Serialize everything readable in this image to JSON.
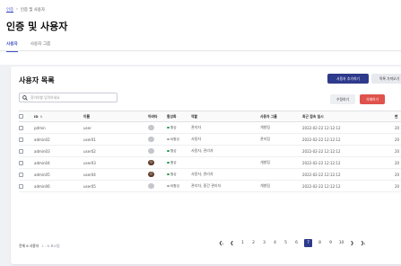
{
  "breadcrumb": {
    "home": "인증",
    "separator": "›",
    "current": "인증 및 사용자"
  },
  "page_title": "인증 및 사용자",
  "tabs": [
    {
      "label": "사용자",
      "active": true
    },
    {
      "label": "사용자 그룹",
      "active": false
    }
  ],
  "card": {
    "title": "사용자 목록",
    "add_button": "사용자 추가하기",
    "columns_button": "목록 가져오기",
    "search_placeholder": "찾아야할 입력하세요",
    "edit_button": "수정하기",
    "delete_button": "삭제하기"
  },
  "table": {
    "headers": {
      "id": "ID",
      "name": "이름",
      "avatar": "아바타",
      "status": "활성화",
      "role": "역할",
      "group": "사용자 그룹",
      "last_login": "최근 접속 일시",
      "extra": "변"
    },
    "rows": [
      {
        "id": "pdmin",
        "name": "user",
        "avatar": "gray",
        "status": "활성",
        "status_type": "active",
        "role": "관리자",
        "group": "개발팀",
        "last_login": "2022-02-22 12:12:12",
        "extra": "20"
      },
      {
        "id": "admin02",
        "name": "user01",
        "avatar": "gray",
        "status": "비활성",
        "status_type": "inactive",
        "role": "사용자",
        "group": "관리팀",
        "last_login": "2022-02-22 12:12:12",
        "extra": "20"
      },
      {
        "id": "admin03",
        "name": "user02",
        "avatar": "gray",
        "status": "활성",
        "status_type": "active",
        "role": "사용자, 관리자",
        "group": "",
        "last_login": "2022-02-22 12:12:12",
        "extra": "20"
      },
      {
        "id": "admin04",
        "name": "user03",
        "avatar": "photo",
        "status": "활성",
        "status_type": "active",
        "role": "",
        "group": "개발팀",
        "last_login": "2022-02-22 12:12:12",
        "extra": "20"
      },
      {
        "id": "admin05",
        "name": "user04",
        "avatar": "photo",
        "status": "활성",
        "status_type": "active",
        "role": "사용자, 관리자",
        "group": "",
        "last_login": "2022-02-22 12:12:12",
        "extra": "20"
      },
      {
        "id": "admin06",
        "name": "user05",
        "avatar": "gray",
        "status": "비활성",
        "status_type": "inactive",
        "role": "관리자, 중간 관리자",
        "group": "개발팀",
        "last_login": "2022-02-22 12:12:12",
        "extra": "20"
      }
    ]
  },
  "footer": {
    "total": "전체 6 사용자",
    "range": "1 - 6 표시됨"
  },
  "pagination": {
    "first": "❮",
    "prev": "❮",
    "pages": [
      "1",
      "2",
      "3",
      "4",
      "5",
      "6",
      "7",
      "8",
      "9",
      "10"
    ],
    "current": "7",
    "next": "❯",
    "last": "❯"
  },
  "colors": {
    "primary": "#2e3a8c",
    "danger": "#e0524c",
    "active": "#2c9b5b",
    "inactive": "#9ea3ad"
  }
}
